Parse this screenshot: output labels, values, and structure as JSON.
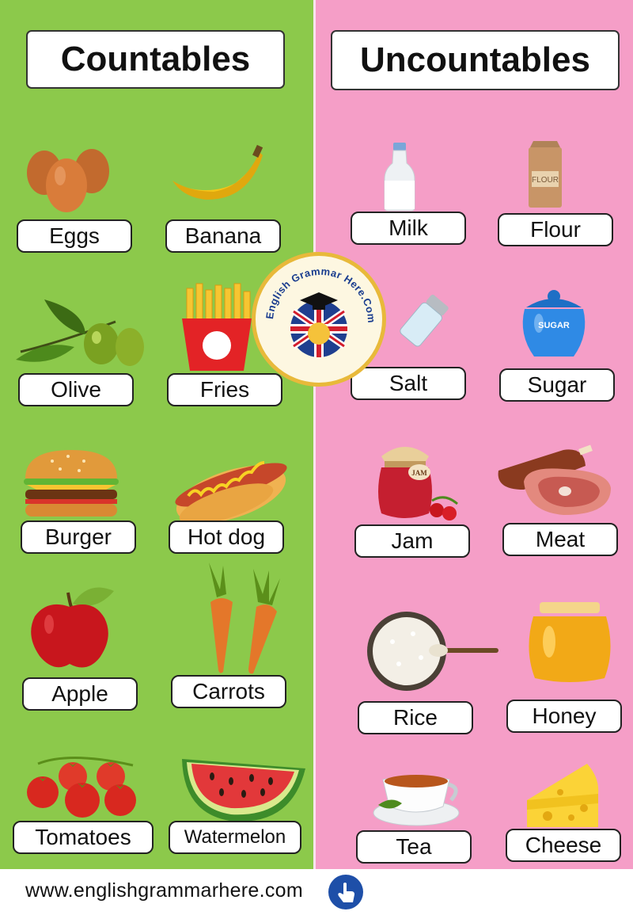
{
  "headers": {
    "countables": "Countables",
    "uncountables": "Uncountables"
  },
  "countables": [
    {
      "label": "Eggs",
      "icon": "eggs-icon"
    },
    {
      "label": "Banana",
      "icon": "banana-icon"
    },
    {
      "label": "Olive",
      "icon": "olive-icon"
    },
    {
      "label": "Fries",
      "icon": "fries-icon"
    },
    {
      "label": "Burger",
      "icon": "burger-icon"
    },
    {
      "label": "Hot dog",
      "icon": "hotdog-icon"
    },
    {
      "label": "Apple",
      "icon": "apple-icon"
    },
    {
      "label": "Carrots",
      "icon": "carrots-icon"
    },
    {
      "label": "Tomatoes",
      "icon": "tomatoes-icon"
    },
    {
      "label": "Watermelon",
      "icon": "watermelon-icon"
    }
  ],
  "uncountables": [
    {
      "label": "Milk",
      "icon": "milk-icon"
    },
    {
      "label": "Flour",
      "icon": "flour-icon",
      "package_text": "FLOUR"
    },
    {
      "label": "Salt",
      "icon": "salt-icon"
    },
    {
      "label": "Sugar",
      "icon": "sugar-icon",
      "package_text": "SUGAR"
    },
    {
      "label": "Jam",
      "icon": "jam-icon",
      "package_text": "JAM"
    },
    {
      "label": "Meat",
      "icon": "meat-icon"
    },
    {
      "label": "Rice",
      "icon": "rice-icon"
    },
    {
      "label": "Honey",
      "icon": "honey-icon"
    },
    {
      "label": "Tea",
      "icon": "tea-icon"
    },
    {
      "label": "Cheese",
      "icon": "cheese-icon"
    }
  ],
  "logo": {
    "text": "English Grammar Here.Com",
    "icon": "graduation-flag-logo-icon"
  },
  "footer": {
    "url": "www.englishgrammarhere.com",
    "icon": "pointing-hand-icon"
  },
  "colors": {
    "countables_bg": "#8cc94b",
    "uncountables_bg": "#f59ec7",
    "logo_ring": "#e8b93a"
  }
}
